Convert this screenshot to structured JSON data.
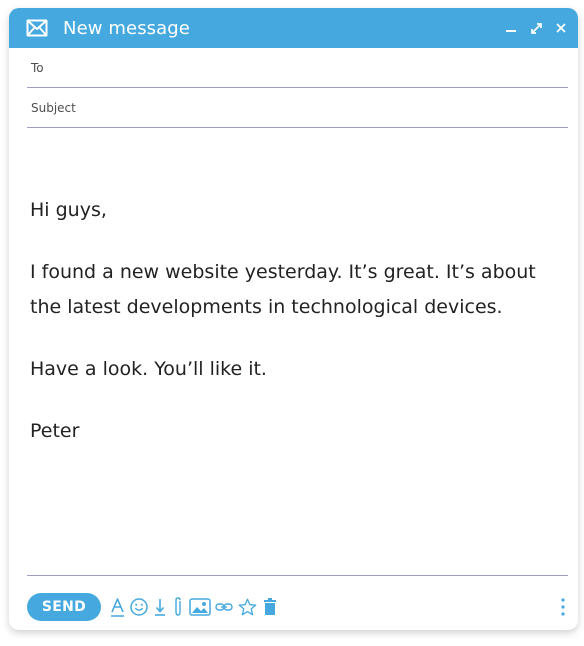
{
  "window": {
    "title": "New message"
  },
  "fields": {
    "to": {
      "label": "To",
      "value": ""
    },
    "subject": {
      "label": "Subject",
      "value": ""
    }
  },
  "message": {
    "greeting": "Hi guys,",
    "paragraph": "I found a new website yesterday. It’s great. It’s about the latest developments in technological devices.",
    "closing_line": "Have a look. You’ll like it.",
    "signature": "Peter"
  },
  "toolbar": {
    "send_label": "SEND",
    "icons": [
      "format-text-icon",
      "emoji-icon",
      "attach-download-icon",
      "paperclip-icon",
      "image-icon",
      "link-icon",
      "star-icon",
      "trash-icon"
    ]
  },
  "colors": {
    "accent": "#45a9df",
    "divider": "#9c9fbf",
    "icon": "#45a9df"
  }
}
